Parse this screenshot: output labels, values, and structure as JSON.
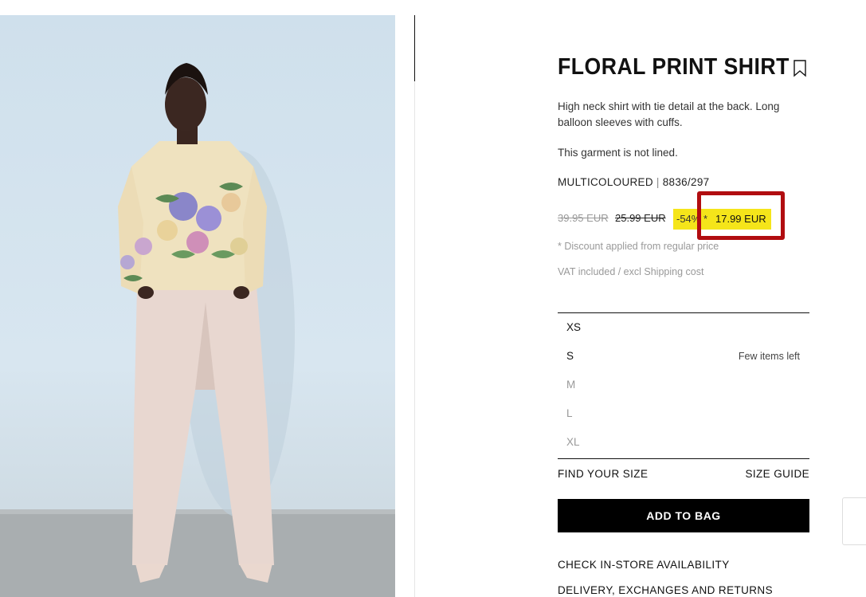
{
  "product": {
    "title": "FLORAL PRINT SHIRT",
    "description": "High neck shirt with tie detail at the back. Long balloon sleeves with cuffs.",
    "lining": "This garment is not lined.",
    "color": "MULTICOLOURED",
    "separator": "|",
    "reference": "8836/297",
    "bookmark_icon": "bookmark-icon"
  },
  "pricing": {
    "original_price": "39.95 EUR",
    "previous_price": "25.99 EUR",
    "discount": "-54% *",
    "final_price": "17.99 EUR",
    "highlight_color": "#f5e51a",
    "annotation_color": "#b10d10",
    "discount_note": "* Discount applied from regular price",
    "vat_note": "VAT included / excl Shipping cost"
  },
  "sizes": [
    {
      "label": "XS",
      "note": "",
      "available": true
    },
    {
      "label": "S",
      "note": "Few items left",
      "available": true
    },
    {
      "label": "M",
      "note": "",
      "available": false
    },
    {
      "label": "L",
      "note": "",
      "available": false
    },
    {
      "label": "XL",
      "note": "",
      "available": false
    }
  ],
  "actions": {
    "find_size": "FIND YOUR SIZE",
    "size_guide": "SIZE GUIDE",
    "add_to_bag": "ADD TO BAG",
    "check_store": "CHECK IN-STORE AVAILABILITY",
    "delivery": "DELIVERY, EXCHANGES AND RETURNS"
  }
}
